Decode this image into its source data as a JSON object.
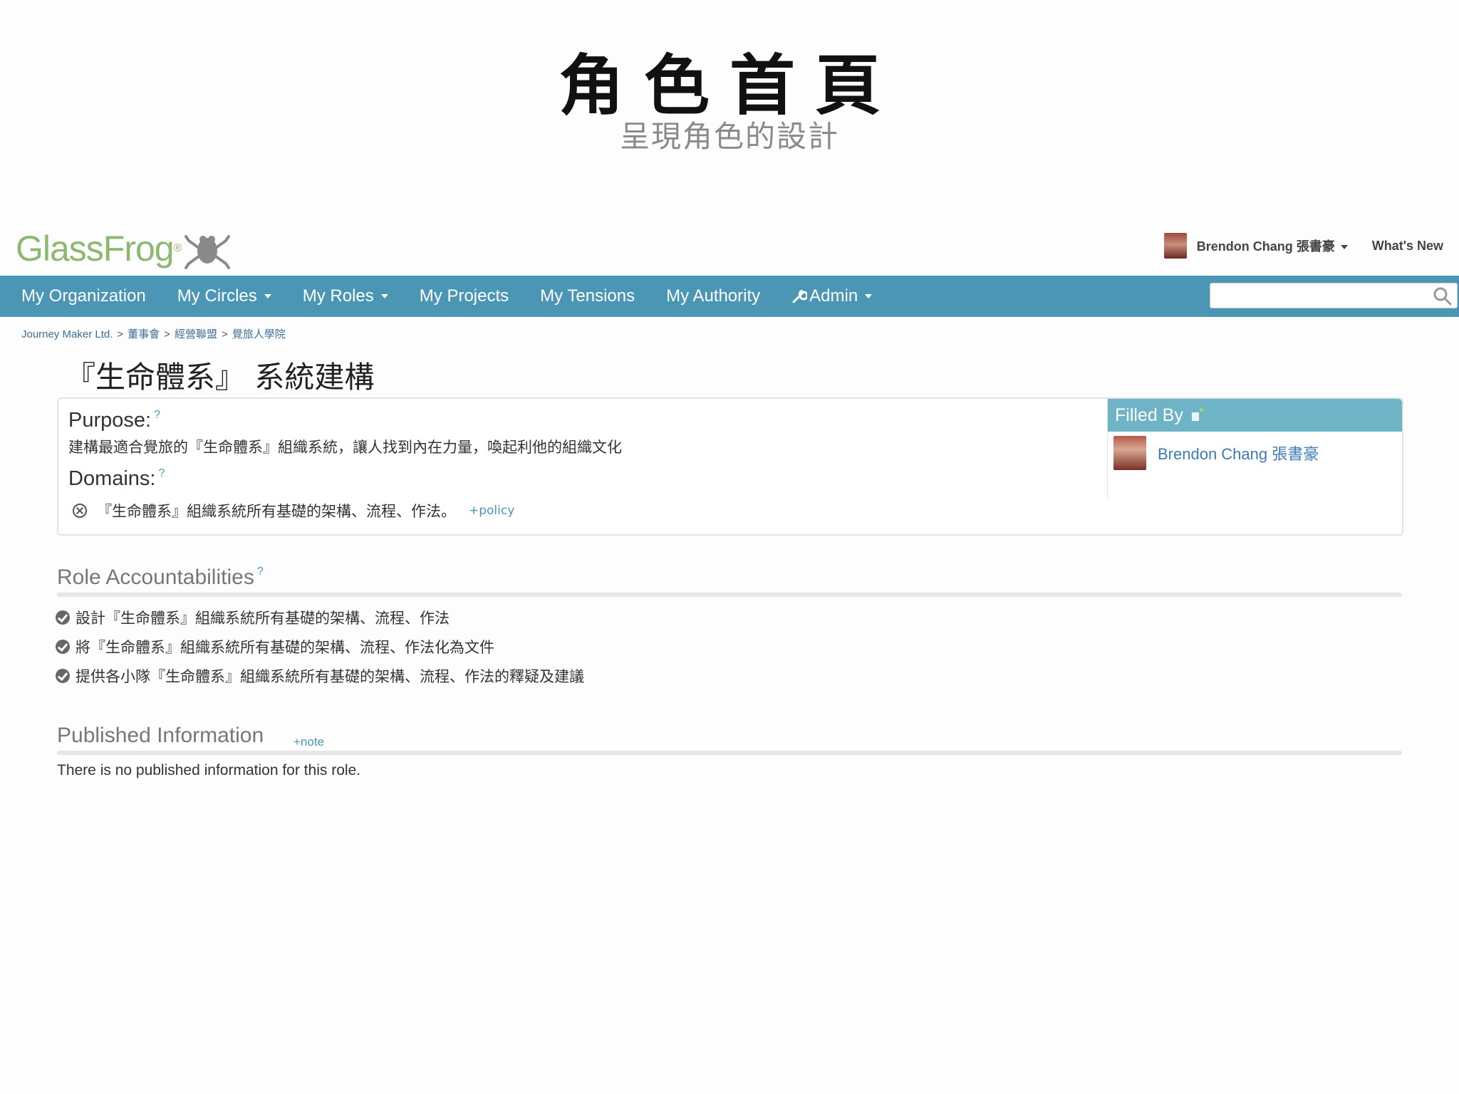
{
  "slide": {
    "title": "角色首頁",
    "subtitle": "呈現角色的設計"
  },
  "app": {
    "logo_text": "GlassFrog",
    "logo_mark": "®",
    "user_name": "Brendon Chang 張書豪",
    "whats_new": "What's New"
  },
  "nav": {
    "items": [
      {
        "label": "My Organization",
        "dropdown": false
      },
      {
        "label": "My Circles",
        "dropdown": true
      },
      {
        "label": "My Roles",
        "dropdown": true
      },
      {
        "label": "My Projects",
        "dropdown": false
      },
      {
        "label": "My Tensions",
        "dropdown": false
      },
      {
        "label": "My Authority",
        "dropdown": false
      },
      {
        "label": "Admin",
        "dropdown": true
      }
    ],
    "search_placeholder": ""
  },
  "breadcrumb": [
    "Journey Maker Ltd.",
    "董事會",
    "經營聯盟",
    "覺旅人學院"
  ],
  "role": {
    "title": "『生命體系』 系統建構",
    "purpose_label": "Purpose:",
    "purpose_text": "建構最適合覺旅的『生命體系』組織系統，讓人找到內在力量，喚起利他的組織文化",
    "domains_label": "Domains:",
    "domains": [
      "『生命體系』組織系統所有基礎的架構、流程、作法。"
    ],
    "add_policy": "+policy",
    "help_mark": "?"
  },
  "filled_by": {
    "label": "Filled By",
    "person": "Brendon Chang 張書豪"
  },
  "accountabilities": {
    "heading": "Role Accountabilities",
    "items": [
      "設計『生命體系』組織系統所有基礎的架構、流程、作法",
      "將『生命體系』組織系統所有基礎的架構、流程、作法化為文件",
      "提供各小隊『生命體系』組織系統所有基礎的架構、流程、作法的釋疑及建議"
    ]
  },
  "published": {
    "heading": "Published Information",
    "add_note": "+note",
    "empty_text": "There is no published information for this role."
  },
  "colors": {
    "nav_bg": "#4b96b5",
    "filled_head_bg": "#6fb3c7",
    "logo_green": "#8cb870",
    "link_blue": "#4b96b5"
  }
}
